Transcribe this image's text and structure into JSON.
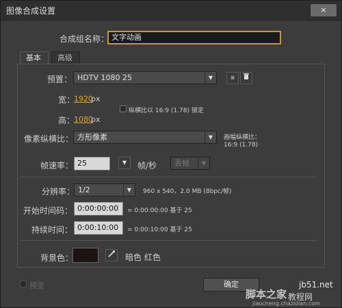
{
  "window": {
    "title": "图像合成设置",
    "close_label": "×"
  },
  "name_field": {
    "label": "合成组名称：",
    "value": "文字动画"
  },
  "tabs": [
    {
      "label": "基本"
    },
    {
      "label": "高级"
    }
  ],
  "preset": {
    "label": "预置：",
    "value": "HDTV 1080 25"
  },
  "width": {
    "label": "宽：",
    "value": "1920",
    "unit": "px"
  },
  "height": {
    "label": "高：",
    "value": "1080",
    "unit": "px"
  },
  "aspect_lock": {
    "label": "纵横比以 16:9 (1.78) 锁定",
    "checked": false
  },
  "pixel_aspect": {
    "label": "像素纵横比：",
    "value": "方形像素"
  },
  "frame_aspect": {
    "label": "画幅纵横比：",
    "value": "16:9 (1.78)"
  },
  "frame_rate": {
    "label": "帧速率：",
    "value": "25",
    "unit": "帧/秒",
    "dropframe": "丢帧"
  },
  "resolution": {
    "label": "分辨率：",
    "value": "1/2",
    "info": "960 x 540，2.0 MB (8bpc/帧)"
  },
  "start_timecode": {
    "label": "开始时间码：",
    "value": "0:00:00:00",
    "info": "= 0:00:00:00  基于 25"
  },
  "duration": {
    "label": "持续时间：",
    "value": "0:00:10:00",
    "info": "= 0:00:10:00  基于 25"
  },
  "background": {
    "label": "背景色：",
    "color_name": "暗色 红色",
    "color": "#1c1414"
  },
  "preview": {
    "label": "预览",
    "checked": false
  },
  "ok_button": {
    "label": "确定"
  },
  "watermark": {
    "site": "jb51.net",
    "text1": "脚本之家",
    "text2": "教程网",
    "url": "jiaocheng.chazidian.com"
  },
  "accent_color": "#e3a23a"
}
